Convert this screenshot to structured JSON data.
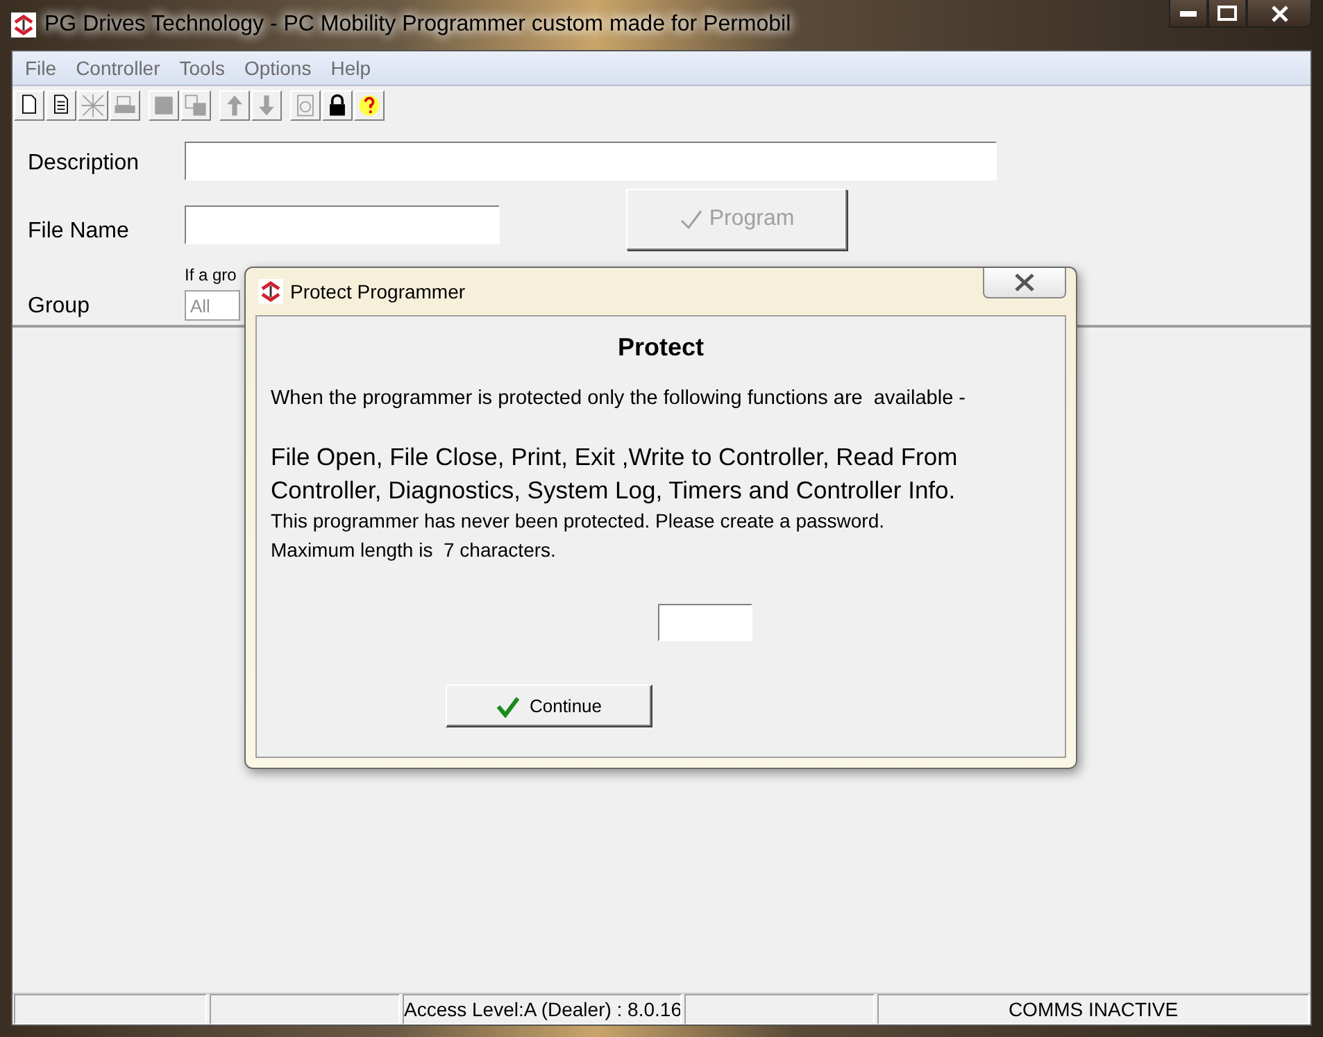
{
  "window": {
    "title": "PG Drives Technology - PC Mobility Programmer custom made for Permobil"
  },
  "menu": [
    "File",
    "Controller",
    "Tools",
    "Options",
    "Help"
  ],
  "toolbar": [
    [
      {
        "disabled": false
      },
      {
        "disabled": false
      },
      {
        "disabled": true
      },
      {
        "disabled": true
      }
    ],
    [
      {
        "disabled": true
      },
      {
        "disabled": true
      }
    ],
    [
      {
        "disabled": true
      },
      {
        "disabled": true
      }
    ],
    [
      {
        "disabled": true
      },
      {
        "disabled": false
      },
      {
        "disabled": false
      }
    ]
  ],
  "form": {
    "description_label": "Description",
    "file_name_label": "File Name",
    "program_button": {
      "label": "Program",
      "disabled": true
    },
    "hint": "If a gro",
    "group_label": "Group",
    "group_value": "All"
  },
  "dialog": {
    "title": "Protect Programmer",
    "heading": "Protect",
    "intro": "When the programmer is protected only the following functions are  available -",
    "functions": "File Open, File Close, Print, Exit ,Write to Controller, Read From Controller, Diagnostics, System Log, Timers and Controller Info.",
    "message": "This programmer has never been protected. Please create a password.",
    "limit": "Maximum length is  7 characters.",
    "continue_button": "Continue"
  },
  "status_bar": {
    "access": "Access Level:A (Dealer) : 8.0.16",
    "comms": "COMMS INACTIVE"
  }
}
